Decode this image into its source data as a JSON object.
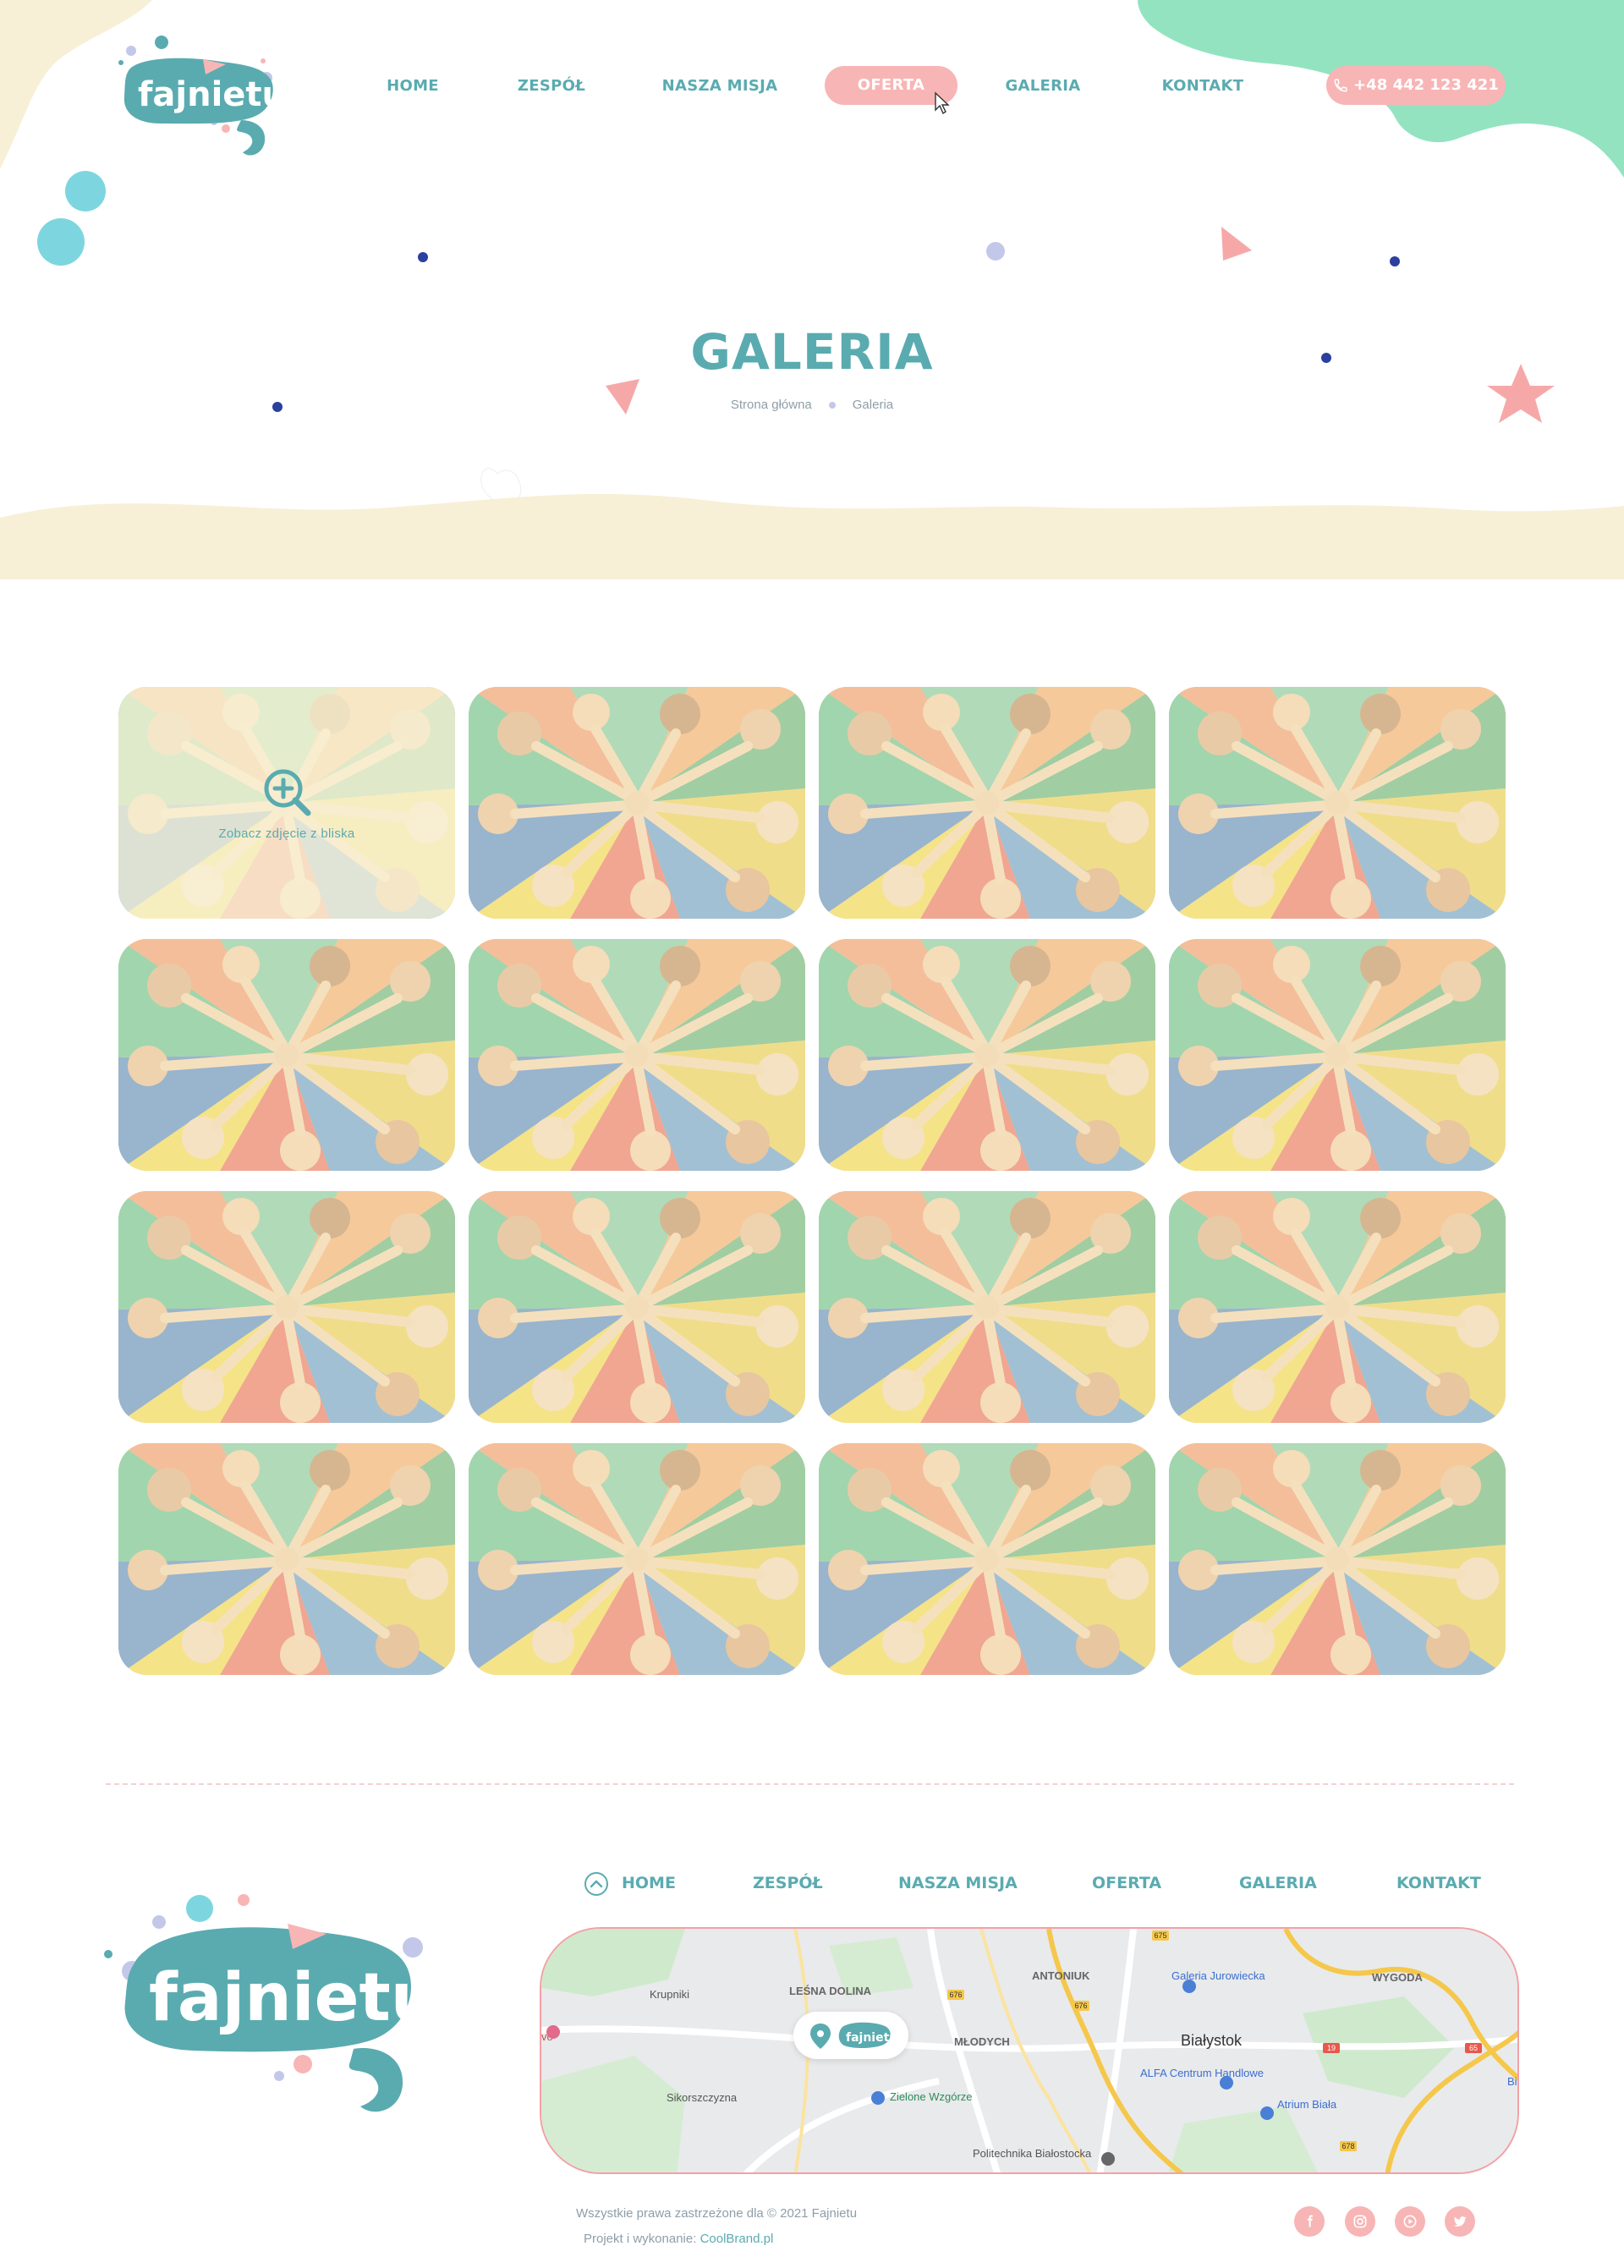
{
  "brand": {
    "logo_text": "fajnietu"
  },
  "nav": {
    "items": [
      {
        "label": "HOME",
        "active": false
      },
      {
        "label": "ZESPÓŁ",
        "active": false
      },
      {
        "label": "NASZA MISJA",
        "active": false
      },
      {
        "label": "OFERTA",
        "active": true
      },
      {
        "label": "GALERIA",
        "active": false
      },
      {
        "label": "KONTAKT",
        "active": false
      }
    ],
    "phone": "+48 442 123 421"
  },
  "hero": {
    "title": "GALERIA",
    "breadcrumb": [
      "Strona główna",
      "Galeria"
    ]
  },
  "gallery": {
    "tile_count": 16,
    "hovered_index": 0,
    "hover_caption": "Zobacz zdjęcie z bliska"
  },
  "footer": {
    "nav": [
      "HOME",
      "ZESPÓŁ",
      "NASZA MISJA",
      "OFERTA",
      "GALERIA",
      "KONTAKT"
    ],
    "map_labels": [
      "Krupniki",
      "LEŚNA DOLINA",
      "ANTONIUK",
      "Galeria Jurowiecka",
      "WYGODA",
      "MŁODYCH",
      "Białystok",
      "ALFA Centrum Handlowe",
      "Atrium Biała",
      "Sikorszczyzna",
      "Zielone Wzgórze",
      "Politechnika Białostocka",
      "Bi",
      "vo"
    ],
    "map_road_numbers": [
      "675",
      "676",
      "676",
      "19",
      "65",
      "678"
    ],
    "copyright": "Wszystkie prawa zastrzeżone dla © 2021 Fajnietu",
    "credit_label": "Projekt i wykonanie:",
    "credit_brand": "CoolBrand.pl",
    "social": [
      "facebook-icon",
      "instagram-icon",
      "youtube-icon",
      "twitter-icon"
    ]
  },
  "colors": {
    "teal": "#5aabb0",
    "pink": "#f8b5b5",
    "cream": "#f7f0d6",
    "mint": "#93e3c1",
    "navy_dot": "#2b3f9e"
  }
}
